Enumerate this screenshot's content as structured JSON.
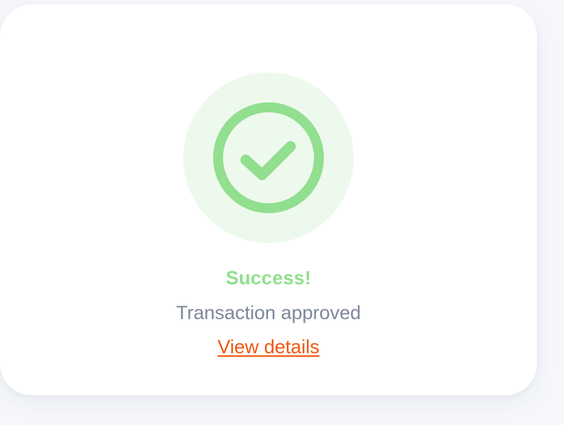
{
  "status": {
    "icon": "check-circle-icon",
    "title": "Success!",
    "message": "Transaction approved",
    "link_label": "View details"
  },
  "colors": {
    "success": "#91df8f",
    "success_bg": "#eef9ee",
    "message": "#7e879a",
    "link": "#f0570c",
    "page_bg": "#f5f7fb",
    "card_bg": "#ffffff"
  }
}
